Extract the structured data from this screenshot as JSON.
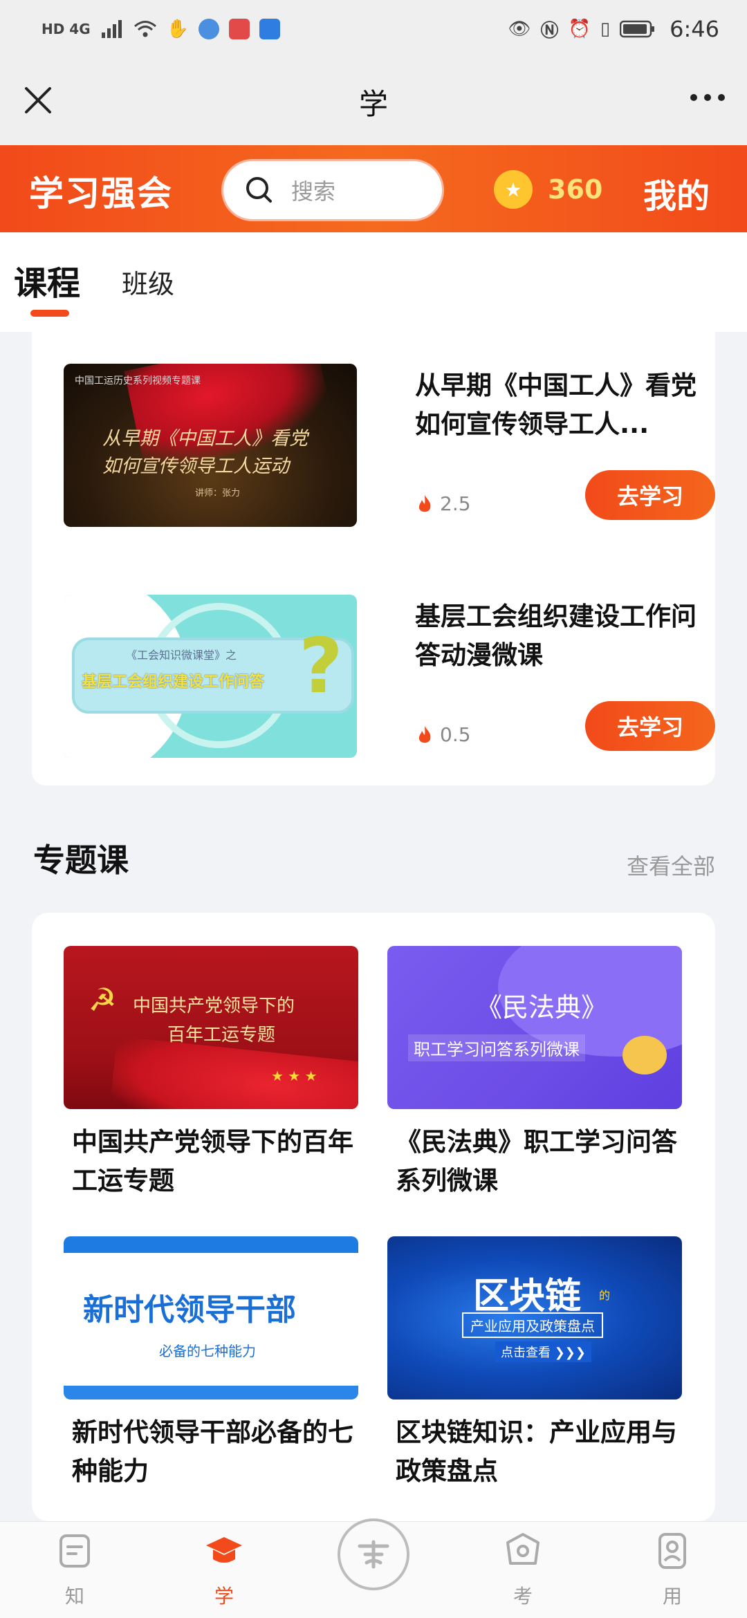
{
  "status_bar": {
    "left_label": "HD 4G",
    "time": "6:46"
  },
  "nav": {
    "title": "学"
  },
  "header": {
    "app_name": "学习强会",
    "search_placeholder": "搜索",
    "points": "360",
    "mine": "我的"
  },
  "tabs": [
    {
      "label": "课程",
      "active": true
    },
    {
      "label": "班级",
      "active": false
    }
  ],
  "courses": [
    {
      "title": "从早期《中国工人》看党如何宣传领导工人...",
      "heat": "2.5",
      "button": "去学习",
      "thumb_header": "中国工运历史系列视频专题课",
      "thumb_line1": "从早期《中国工人》看党",
      "thumb_line2": "如何宣传领导工人运动",
      "thumb_speaker": "讲师：张力"
    },
    {
      "title": "基层工会组织建设工作问答动漫微课",
      "heat": "0.5",
      "button": "去学习",
      "thumb_line1": "《工会知识微课堂》之",
      "thumb_line2": "基层工会组织建设工作问答"
    }
  ],
  "topics_section": {
    "title": "专题课",
    "view_all": "查看全部",
    "items": [
      {
        "title": "中国共产党领导下的百年工运专题",
        "img_line1": "中国共产党领导下的",
        "img_line2": "百年工运专题"
      },
      {
        "title": "《民法典》职工学习问答系列微课",
        "img_line1": "《民法典》",
        "img_line2": "职工学习问答系列微课"
      },
      {
        "title": "新时代领导干部必备的七种能力",
        "img_line1": "新时代领导干部",
        "img_line2": "必备的七种能力"
      },
      {
        "title": "区块链知识：产业应用与政策盘点",
        "img_line1": "区块链",
        "img_line1b": "的",
        "img_line2": "产业应用及政策盘点",
        "img_line3": "点击查看 ❯❯❯"
      }
    ]
  },
  "bottom_nav": [
    {
      "label": "知",
      "icon": "knowledge-icon"
    },
    {
      "label": "学",
      "icon": "graduation-cap-icon",
      "active": true
    },
    {
      "label": "",
      "icon": "center-logo-icon"
    },
    {
      "label": "考",
      "icon": "exam-icon"
    },
    {
      "label": "用",
      "icon": "apply-icon"
    }
  ],
  "colors": {
    "brand_orange": "#f24a1a",
    "points_yellow": "#ffe27a",
    "inactive_gray": "#9a9a9a"
  }
}
